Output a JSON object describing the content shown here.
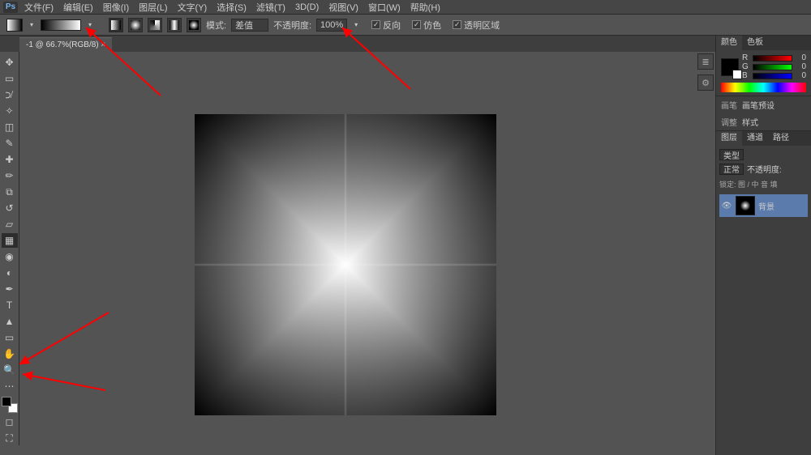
{
  "app": {
    "logo": "Ps"
  },
  "menu": {
    "file": "文件(F)",
    "edit": "编辑(E)",
    "image": "图像(I)",
    "layer": "图层(L)",
    "type": "文字(Y)",
    "select": "选择(S)",
    "filter": "滤镜(T)",
    "threeD": "3D(D)",
    "view": "视图(V)",
    "window": "窗口(W)",
    "help": "帮助(H)"
  },
  "options": {
    "mode_label": "模式:",
    "mode_value": "差值",
    "opacity_label": "不透明度:",
    "opacity_value": "100%",
    "reverse": "反向",
    "dither": "仿色",
    "transparency": "透明区域",
    "reverse_checked": "✓",
    "dither_checked": "✓",
    "transparency_checked": "✓"
  },
  "doc": {
    "tab": "-1 @ 66.7%(RGB/8) ×"
  },
  "panels": {
    "color_tab": "颜色",
    "swatches_tab": "色板",
    "rgb": {
      "r_label": "R",
      "g_label": "G",
      "b_label": "B",
      "r": "0",
      "g": "0",
      "b": "0"
    },
    "brush_tab": "画笔",
    "brush_preset": "画笔预设",
    "adjust_tab": "调整",
    "style": "样式",
    "layers_tab": "图层",
    "channels_tab": "通道",
    "paths_tab": "路径",
    "blend_label": "类型",
    "opacity_lbl": "不透明度:",
    "blend_mode": "正常",
    "lock_label": "锁定: 图 / 中 音 填",
    "layer_name": "背景"
  }
}
